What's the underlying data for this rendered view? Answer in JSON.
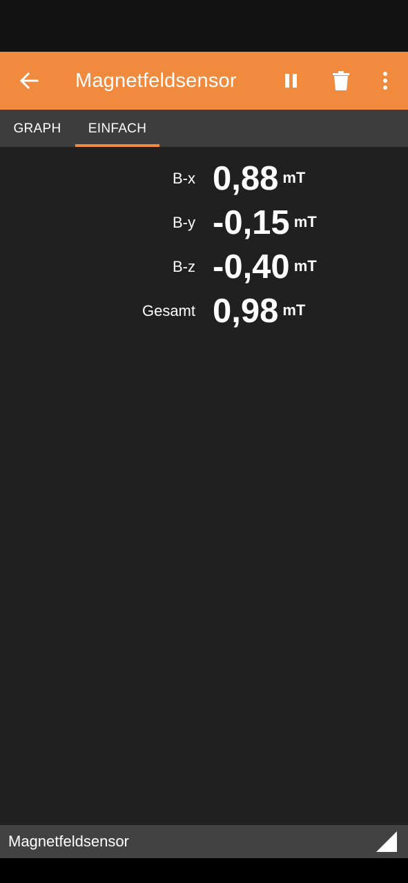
{
  "app_bar": {
    "title": "Magnetfeldsensor",
    "accent_color": "#ef8a3e",
    "icons": [
      "arrow-left-icon",
      "pause-icon",
      "trash-icon",
      "more-vertical-icon"
    ]
  },
  "tabs": [
    {
      "label": "GRAPH",
      "selected": false
    },
    {
      "label": "EINFACH",
      "selected": true
    }
  ],
  "readings": [
    {
      "label": "B-x",
      "value": "0,88",
      "unit": "mT"
    },
    {
      "label": "B-y",
      "value": "-0,15",
      "unit": "mT"
    },
    {
      "label": "B-z",
      "value": "-0,40",
      "unit": "mT"
    },
    {
      "label": "Gesamt",
      "value": "0,98",
      "unit": "mT"
    }
  ],
  "bottom_bar": {
    "label": "Magnetfeldsensor",
    "icon": "resize-corner-icon"
  }
}
